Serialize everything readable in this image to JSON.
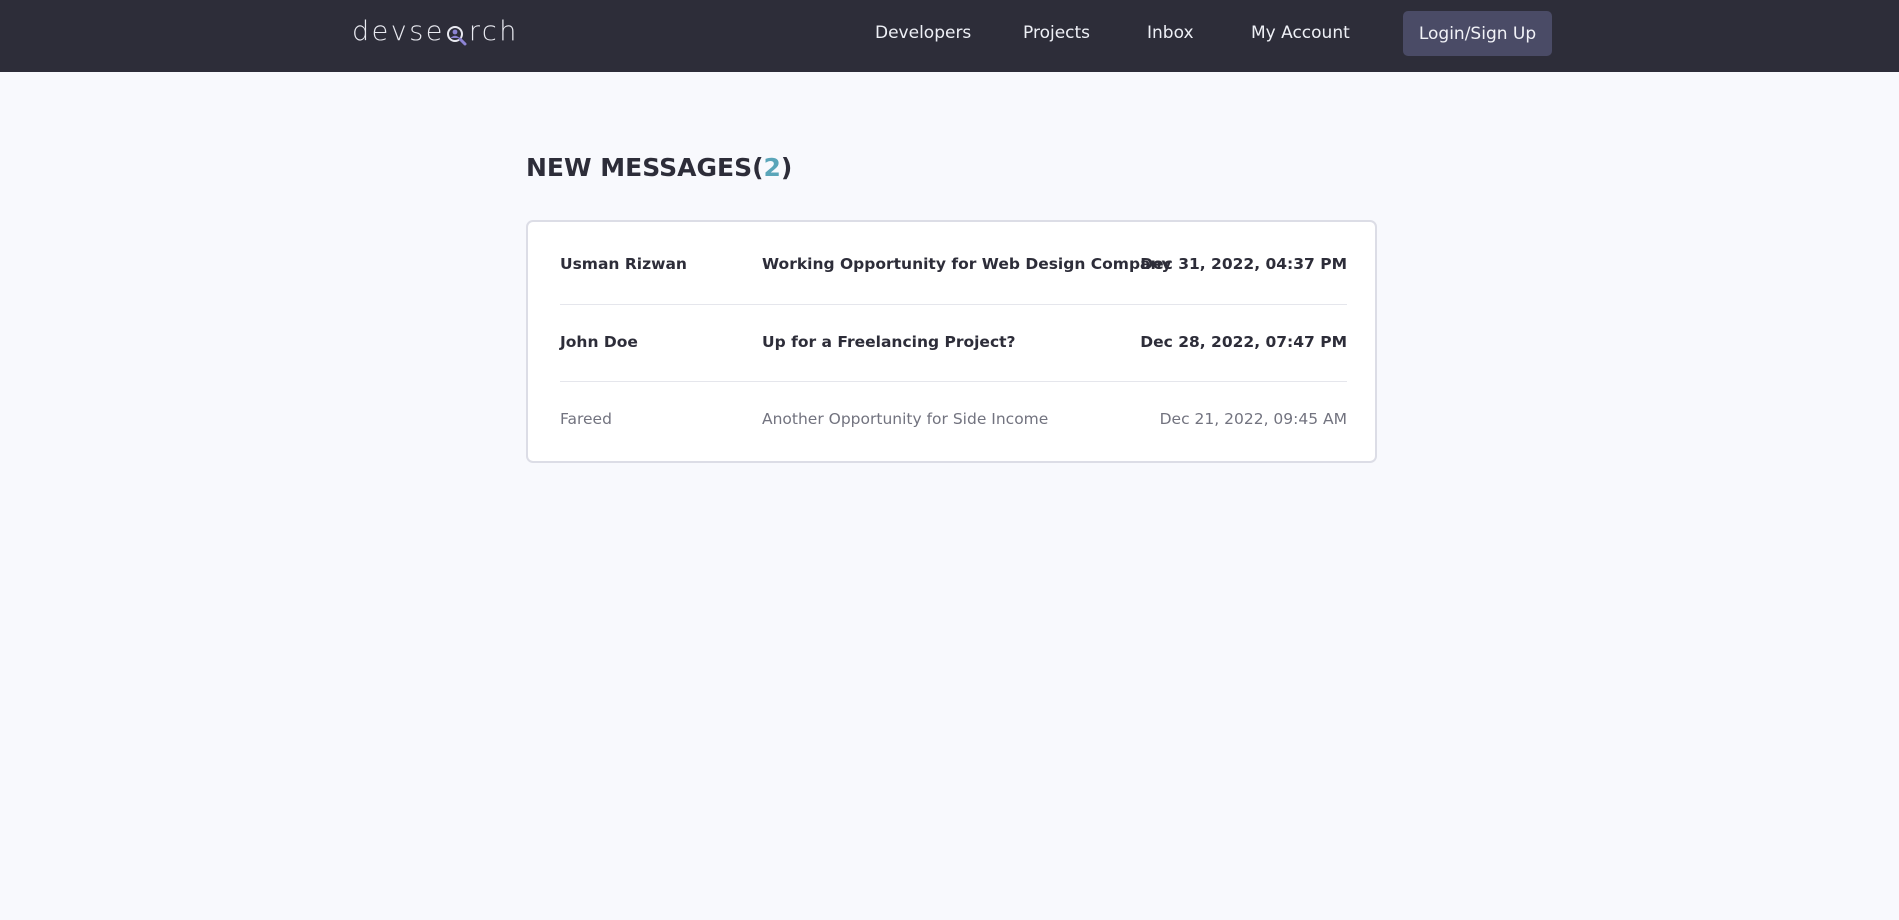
{
  "header": {
    "logo_before": "devse",
    "logo_after": "rch",
    "nav": {
      "developers": "Developers",
      "projects": "Projects",
      "inbox": "Inbox",
      "account": "My Account",
      "login": "Login/Sign Up"
    }
  },
  "page": {
    "title_prefix": "NEW MESSAGES(",
    "unread_count": "2",
    "title_suffix": ")"
  },
  "messages": [
    {
      "sender": "Usman Rizwan",
      "subject": "Working Opportunity for Web Design Company",
      "date": "Dec 31, 2022, 04:37 PM",
      "unread": true
    },
    {
      "sender": "John Doe",
      "subject": "Up for a Freelancing Project?",
      "date": "Dec 28, 2022, 07:47 PM",
      "unread": true
    },
    {
      "sender": "Fareed",
      "subject": "Another Opportunity for Side Income",
      "date": "Dec 21, 2022, 09:45 AM",
      "unread": false
    }
  ],
  "colors": {
    "header_bg": "#2d2d39",
    "button_bg": "#4a4b66",
    "accent": "#5aa5b9",
    "page_bg": "#f8f9fd"
  },
  "icons": {
    "logo_glyph": "magnifier-user-icon"
  }
}
